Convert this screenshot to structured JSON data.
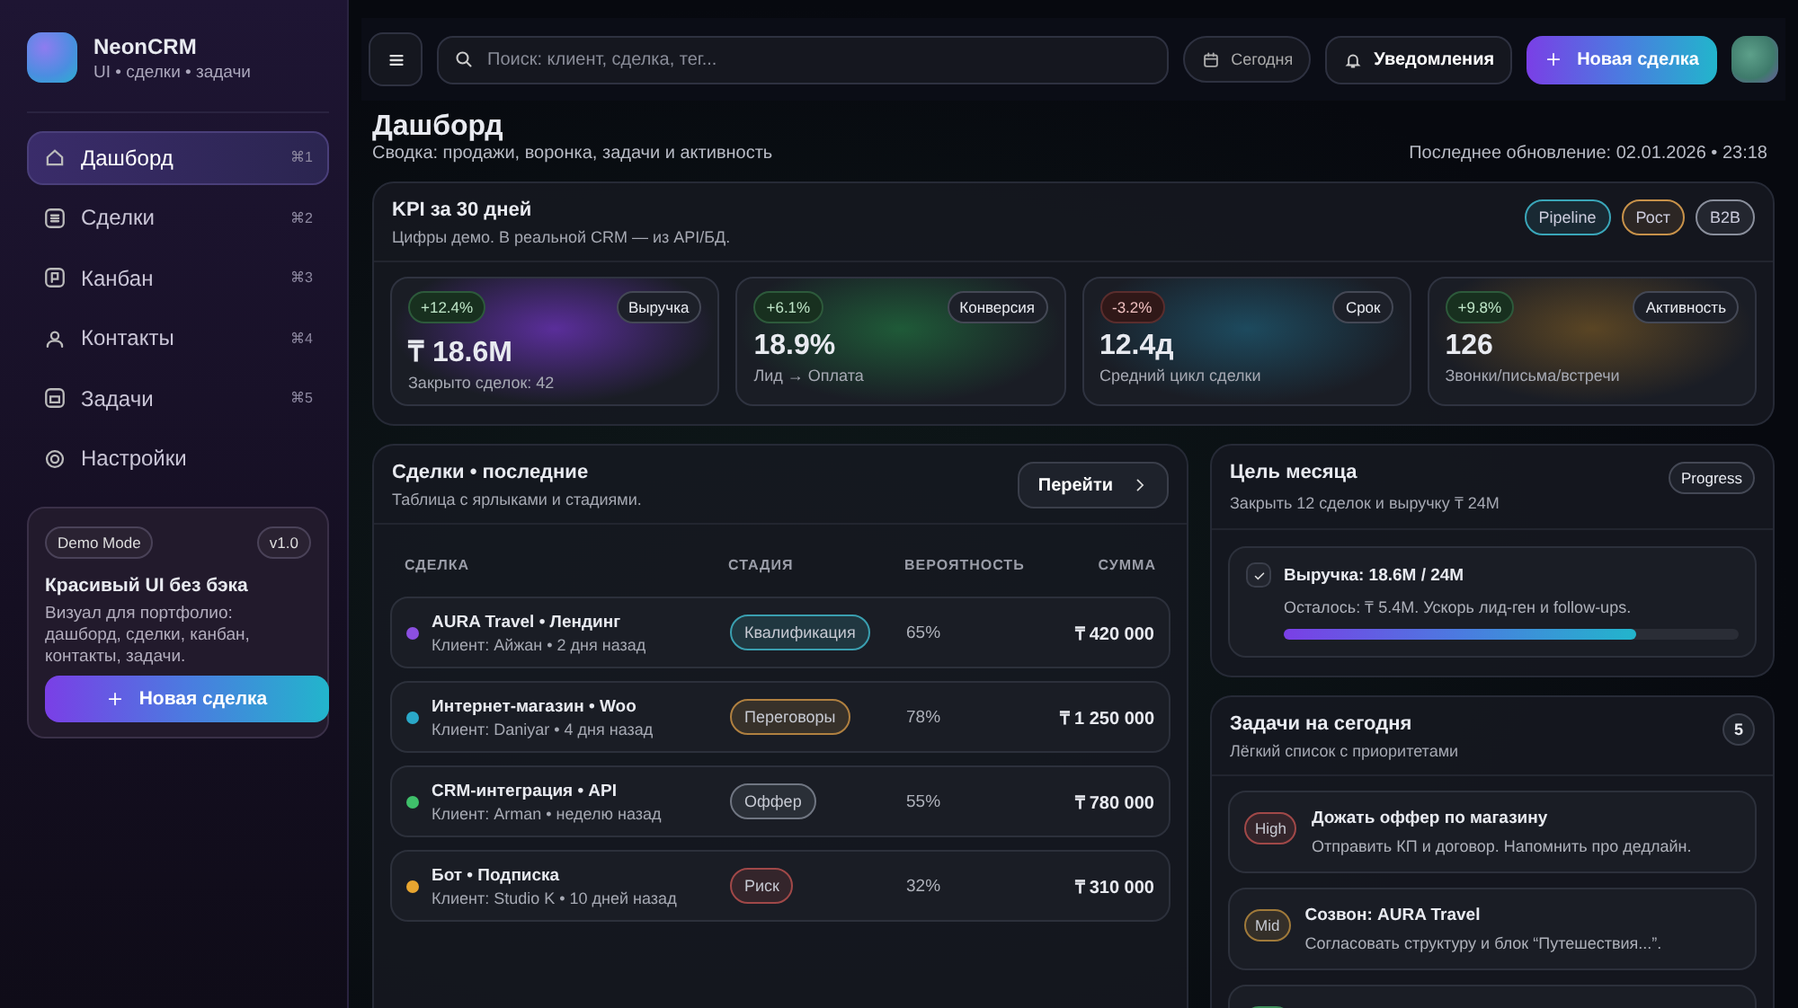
{
  "brand": {
    "name": "NeonCRM",
    "tagline": "UI • сделки • задачи"
  },
  "nav": [
    {
      "label": "Дашборд",
      "shortcut": "⌘1",
      "selected": true
    },
    {
      "label": "Сделки",
      "shortcut": "⌘2",
      "selected": false
    },
    {
      "label": "Канбан",
      "shortcut": "⌘3",
      "selected": false
    },
    {
      "label": "Контакты",
      "shortcut": "⌘4",
      "selected": false
    },
    {
      "label": "Задачи",
      "shortcut": "⌘5",
      "selected": false
    },
    {
      "label": "Настройки",
      "selected": false
    }
  ],
  "promo": {
    "badge": "Demo Mode",
    "version": "v1.0",
    "title": "Красивый UI без бэка",
    "text": "Визуал для портфолио: дашборд, сделки, канбан, контакты, задачи.",
    "button": "Новая сделка"
  },
  "topbar": {
    "search_placeholder": "Поиск: клиент, сделка, тег...",
    "date_button": "Сегодня",
    "notifications_button": "Уведомления",
    "new_button": "Новая сделка"
  },
  "header": {
    "title": "Дашборд",
    "subtitle": "Сводка: продажи, воронка, задачи и активность",
    "updated": "Последнее обновление: 02.01.2026 • 23:18"
  },
  "kpi": {
    "title": "KPI за 30 дней",
    "subtitle": "Цифры демо. В реальной CRM — из API/БД.",
    "tags": [
      {
        "label": "Pipeline",
        "color": "#3aa6b9"
      },
      {
        "label": "Рост",
        "color": "#c8924a"
      },
      {
        "label": "B2B",
        "color": "#8a8f9c"
      }
    ],
    "cards": [
      {
        "delta": "+12.4%",
        "kind": "up",
        "tag": "Выручка",
        "value": "₸ 18.6M",
        "caption": "Закрыто сделок: 42"
      },
      {
        "delta": "+6.1%",
        "kind": "up",
        "tag": "Конверсия",
        "value": "18.9%",
        "caption": "Лид → Оплата"
      },
      {
        "delta": "-3.2%",
        "kind": "down",
        "tag": "Срок",
        "value": "12.4д",
        "caption": "Средний цикл сделки"
      },
      {
        "delta": "+9.8%",
        "kind": "up",
        "tag": "Активность",
        "value": "126",
        "caption": "Звонки/письма/встречи"
      }
    ]
  },
  "deals": {
    "title": "Сделки • последние",
    "subtitle": "Таблица с ярлыками и стадиями.",
    "button": "Перейти",
    "columns": [
      "СДЕЛКА",
      "СТАДИЯ",
      "ВЕРОЯТНОСТЬ",
      "СУММА"
    ],
    "rows": [
      {
        "name": "AURA Travel • Лендинг",
        "client": "Клиент: Айжан • 2 дня назад",
        "color": "#8b4fe0",
        "stage": {
          "label": "Квалификация",
          "color": "#3a9fb0"
        },
        "probability": "65%",
        "amount": "₸ 420 000"
      },
      {
        "name": "Интернет-магазин • Woo",
        "client": "Клиент: Daniyar • 4 дня назад",
        "color": "#2aa8c8",
        "stage": {
          "label": "Переговоры",
          "color": "#b08040"
        },
        "probability": "78%",
        "amount": "₸ 1 250 000"
      },
      {
        "name": "CRM-интеграция • API",
        "client": "Клиент: Arman • неделю назад",
        "color": "#3fbf6a",
        "stage": {
          "label": "Оффер",
          "color": "#707682"
        },
        "probability": "55%",
        "amount": "₸ 780 000"
      },
      {
        "name": "Бот • Подписка",
        "client": "Клиент: Studio K • 10 дней назад",
        "color": "#e8a530",
        "stage": {
          "label": "Риск",
          "color": "#a04848"
        },
        "probability": "32%",
        "amount": "₸ 310 000"
      }
    ]
  },
  "goal": {
    "title": "Цель месяца",
    "subtitle": "Закрыть 12 сделок и выручку ₸ 24M",
    "tag": "Progress",
    "item": {
      "checked": true,
      "title": "Выручка: 18.6M / 24M",
      "text": "Осталось: ₸ 5.4M. Ускорь лид-ген и follow-ups.",
      "level": 0.775
    }
  },
  "tasks": {
    "title": "Задачи на сегодня",
    "subtitle": "Лёгкий список с приоритетами",
    "count": "5",
    "items": [
      {
        "priority": "High",
        "color": "#a04848",
        "title": "Дожать оффер по магазину",
        "text": "Отправить КП и договор. Напомнить про дедлайн."
      },
      {
        "priority": "Mid",
        "color": "#a07a3a",
        "title": "Созвон: AURA Travel",
        "text": "Согласовать структуру и блок “Путешествия...”."
      },
      {
        "color": "#3f8f5a"
      }
    ]
  }
}
